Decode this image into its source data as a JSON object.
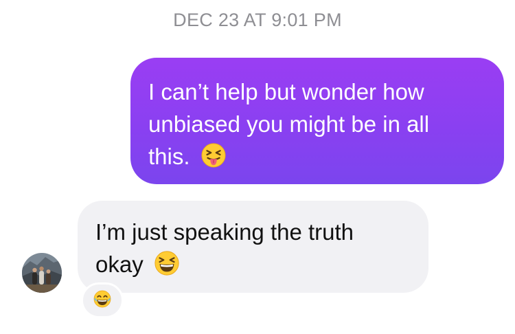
{
  "timestamp": "DEC 23 AT 9:01 PM",
  "messages": [
    {
      "direction": "outgoing",
      "lines": [
        "I can’t help but wonder how",
        "unbiased you might be in all",
        "this."
      ],
      "emoji": "squinting-face-with-tongue-icon",
      "bubble_color": "#8b40f1"
    },
    {
      "direction": "incoming",
      "lines": [
        "I’m just speaking the truth",
        "okay"
      ],
      "emoji": "grinning-squinting-face-icon",
      "bubble_color": "#f1f1f4",
      "reaction": "face-with-tears-of-joy-icon"
    }
  ],
  "colors": {
    "accent": "#8b40f1",
    "timestamp": "#8e8e93",
    "incoming_bg": "#f1f1f4"
  }
}
